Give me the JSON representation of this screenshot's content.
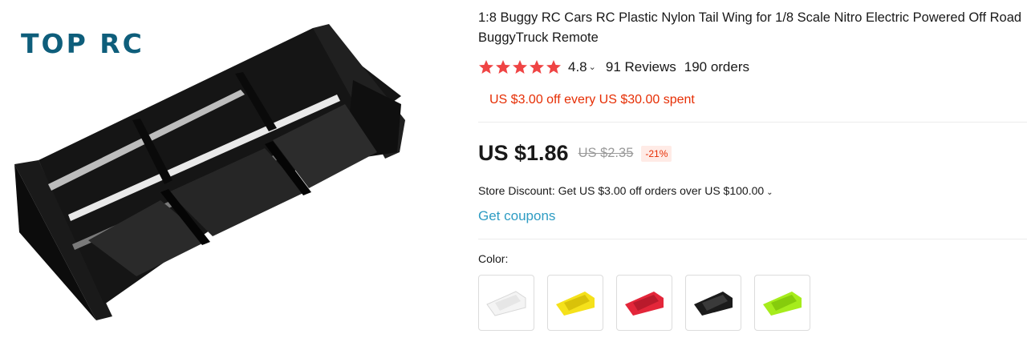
{
  "brand": {
    "logo_text": "TOP RC"
  },
  "product": {
    "title": "1:8 Buggy RC Cars RC Plastic Nylon Tail Wing for 1/8 Scale Nitro Electric Powered Off Road BuggyTruck Remote",
    "rating": "4.8",
    "reviews": "91 Reviews",
    "orders": "190 orders",
    "promo": "US $3.00 off every US $30.00 spent",
    "price": "US $1.86",
    "original_price": "US $2.35",
    "discount": "-21%",
    "store_discount": "Store Discount: Get US $3.00 off orders over US $100.00",
    "get_coupons": "Get coupons",
    "color_label": "Color:",
    "colors": [
      {
        "name": "white",
        "color": "#f4f4f4"
      },
      {
        "name": "yellow",
        "color": "#f5e11b"
      },
      {
        "name": "red",
        "color": "#e3263a"
      },
      {
        "name": "black",
        "color": "#1b1b1b"
      },
      {
        "name": "green",
        "color": "#a6ec1c"
      }
    ]
  },
  "colors": {
    "accent_red": "#e62e04",
    "link_blue": "#2e9cc3",
    "star": "#ef4444",
    "brand_teal": "#0e5e7b"
  }
}
